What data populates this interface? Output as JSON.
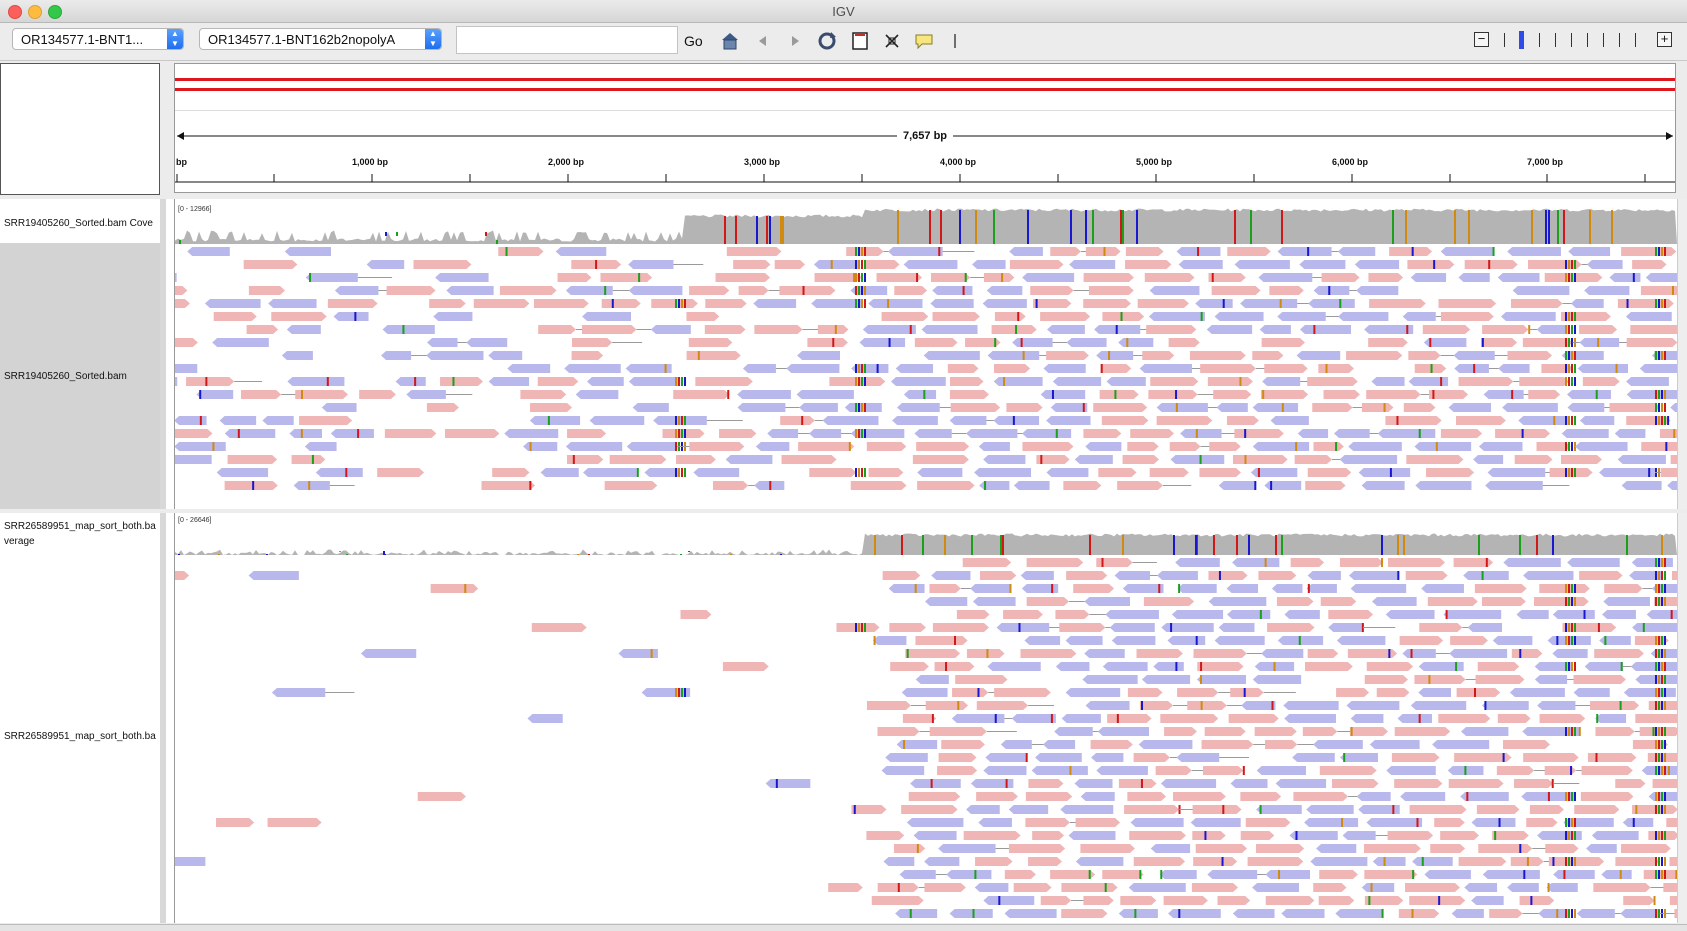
{
  "window": {
    "title": "IGV"
  },
  "toolbar": {
    "genome_value": "OR134577.1-BNT1...",
    "chromosome_value": "OR134577.1-BNT162b2nopolyA",
    "locus_value": "",
    "go_label": "Go",
    "icons": [
      "home-icon",
      "back-icon",
      "forward-icon",
      "refresh-icon",
      "roi-icon",
      "resize-icon",
      "popup-text-icon",
      "ruler-line-icon"
    ],
    "zoom_minus": "−",
    "zoom_plus": "+",
    "zoom_level": 1
  },
  "ruler": {
    "span_label": "7,657 bp",
    "start_label": "bp",
    "ticks": [
      "1,000 bp",
      "2,000 bp",
      "3,000 bp",
      "4,000 bp",
      "5,000 bp",
      "6,000 bp",
      "7,000 bp"
    ]
  },
  "tracks": [
    {
      "coverage_name": "SRR19405260_Sorted.bam Cove",
      "coverage_range": "[0 - 12966]",
      "alignment_name": "SRR19405260_Sorted.bam"
    },
    {
      "coverage_name": "SRR26589951_map_sort_both.ba",
      "coverage_name_line2": "verage",
      "coverage_range": "[0 - 26646]",
      "alignment_name": "SRR26589951_map_sort_both.ba"
    }
  ],
  "colors": {
    "forward_read": "#f0b6b6",
    "reverse_read": "#b9b8ec",
    "coverage": "#b4b4b4",
    "sequence_line": "#e0161e",
    "mismatch_a": "#1aa01a",
    "mismatch_c": "#1818d0",
    "mismatch_g": "#d08a10",
    "mismatch_t": "#d01818"
  }
}
